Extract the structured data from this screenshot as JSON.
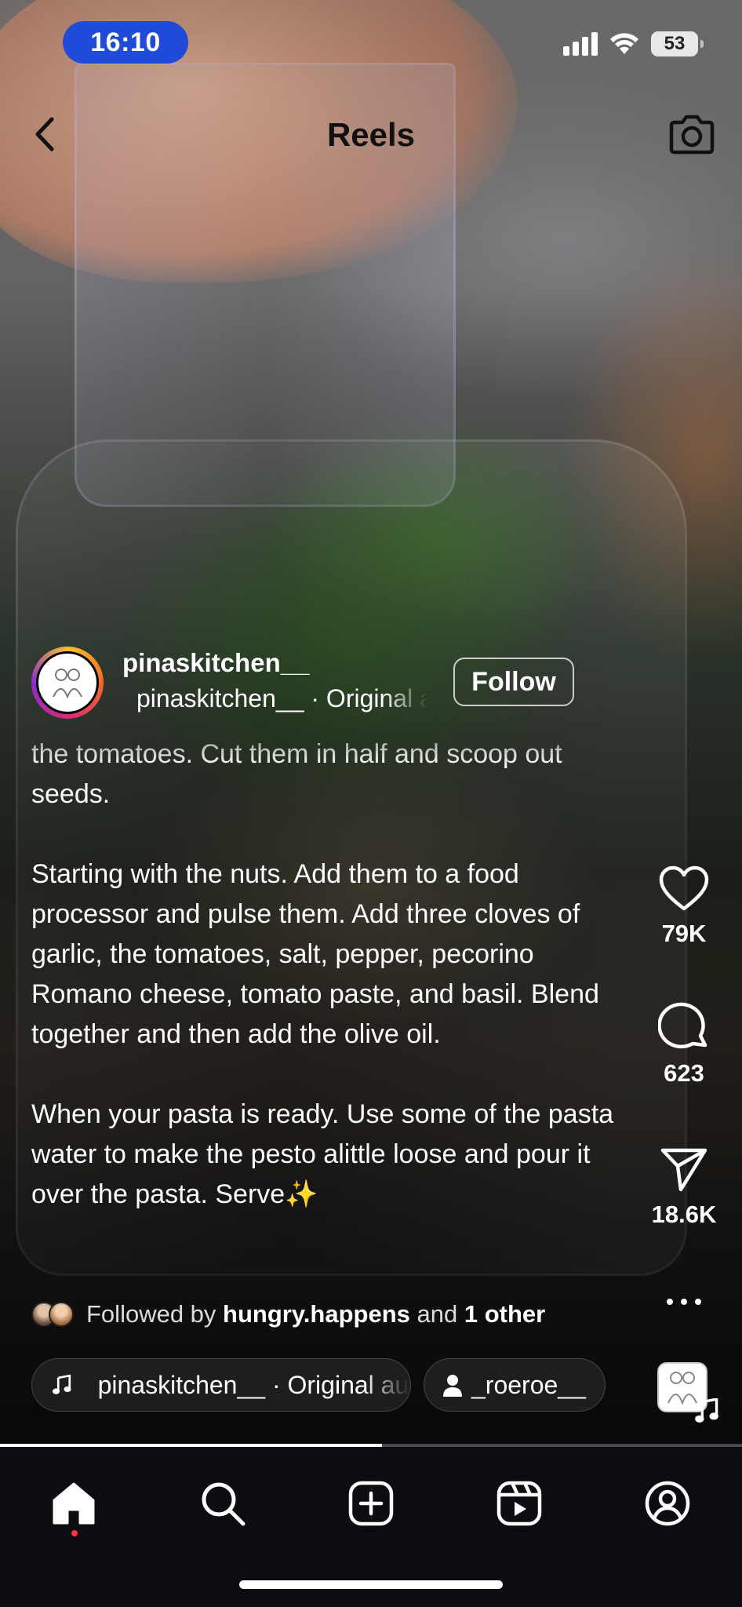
{
  "status_bar": {
    "time": "16:10",
    "battery": "53"
  },
  "header": {
    "title": "Reels",
    "back_icon": "chevron-left-icon",
    "camera_icon": "camera-icon"
  },
  "reel": {
    "username": "pinaskitchen__",
    "audio_line": "pinaskitchen__ · Original audio",
    "follow_label": "Follow",
    "caption": {
      "p1": "the tomatoes. Cut them in half and scoop out seeds.",
      "p2": "Starting with the nuts. Add them to a food processor and pulse them. Add three cloves of garlic,  the tomatoes, salt, pepper, pecorino Romano cheese, tomato paste, and basil. Blend together and then add the olive oil.",
      "p3": "When your pasta is ready. Use some of the pasta water to make the pesto alittle loose and pour it over the pasta. Serve✨"
    },
    "followed_by": {
      "prefix": "Followed by",
      "user": "hungry.happens",
      "conjunction": "and",
      "others": "1 other"
    },
    "audio_chip": "pinaskitchen__ · Original audio",
    "tagged_user": "_roeroe__",
    "progress": 0.515
  },
  "actions": {
    "likes": "79K",
    "comments": "623",
    "shares": "18.6K"
  },
  "tabbar": {
    "items": [
      "home-icon",
      "search-icon",
      "create-icon",
      "reels-icon",
      "profile-icon"
    ],
    "active": "home-icon",
    "notification_color": "#ff3040"
  },
  "colors": {
    "time_pill": "#1f4bd8",
    "tabbar_bg": "#0c0d10"
  }
}
